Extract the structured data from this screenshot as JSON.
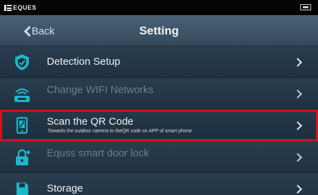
{
  "statusbar": {
    "brand": "EQUES"
  },
  "header": {
    "back_label": "Back",
    "title": "Setting"
  },
  "rows": [
    {
      "title": "Detection Setup",
      "subtitle": "",
      "icon": "shield-icon",
      "enabled": true
    },
    {
      "title": "Change WIFI Networks",
      "subtitle": "",
      "icon": "wifi-icon",
      "enabled": false
    },
    {
      "title": "Scan the QR Code",
      "subtitle": "Towards the outdoor camera to theQR code on APP of smart phone",
      "icon": "qr-phone-icon",
      "enabled": true
    },
    {
      "title": "Equss smart door lock",
      "subtitle": "",
      "icon": "door-lock-icon",
      "enabled": false
    },
    {
      "title": "Storage",
      "subtitle": "",
      "icon": "storage-icon",
      "enabled": true
    }
  ],
  "colors": {
    "highlight": "#d4131d",
    "accent_teal": "#1bb8c8",
    "header_bg": "#3f566a"
  }
}
